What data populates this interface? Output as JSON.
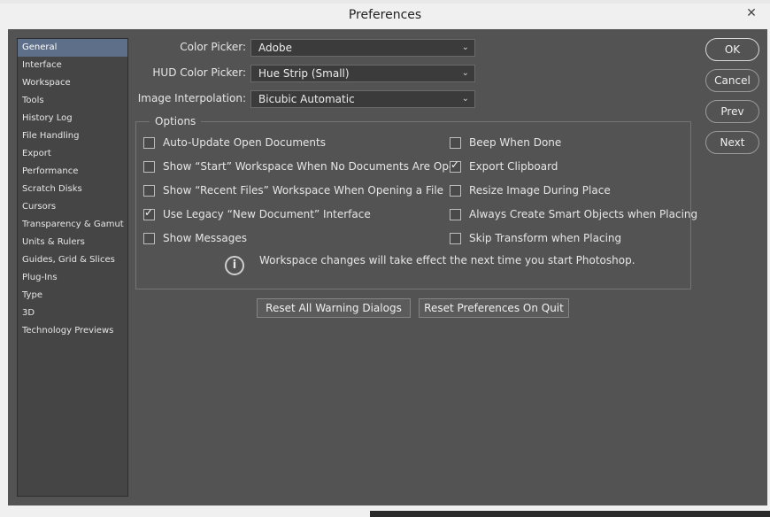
{
  "window": {
    "title": "Preferences",
    "close_glyph": "✕"
  },
  "sidebar": {
    "items": [
      {
        "label": "General",
        "active": true
      },
      {
        "label": "Interface"
      },
      {
        "label": "Workspace"
      },
      {
        "label": "Tools"
      },
      {
        "label": "History Log"
      },
      {
        "label": "File Handling"
      },
      {
        "label": "Export"
      },
      {
        "label": "Performance"
      },
      {
        "label": "Scratch Disks"
      },
      {
        "label": "Cursors"
      },
      {
        "label": "Transparency & Gamut"
      },
      {
        "label": "Units & Rulers"
      },
      {
        "label": "Guides, Grid & Slices"
      },
      {
        "label": "Plug-Ins"
      },
      {
        "label": "Type"
      },
      {
        "label": "3D"
      },
      {
        "label": "Technology Previews"
      }
    ]
  },
  "form": {
    "color_picker": {
      "label": "Color Picker:",
      "value": "Adobe"
    },
    "hud_color_picker": {
      "label": "HUD Color Picker:",
      "value": "Hue Strip (Small)"
    },
    "image_interpolation": {
      "label": "Image Interpolation:",
      "value": "Bicubic Automatic"
    }
  },
  "options": {
    "title": "Options",
    "left": [
      {
        "label": "Auto-Update Open Documents",
        "checked": false
      },
      {
        "label": "Show “Start” Workspace When No Documents Are Open",
        "checked": false
      },
      {
        "label": "Show “Recent Files” Workspace When Opening a File",
        "checked": false
      },
      {
        "label": "Use Legacy “New Document” Interface",
        "checked": true
      },
      {
        "label": "Show Messages",
        "checked": false
      }
    ],
    "right": [
      {
        "label": "Beep When Done",
        "checked": false
      },
      {
        "label": "Export Clipboard",
        "checked": true
      },
      {
        "label": "Resize Image During Place",
        "checked": false
      },
      {
        "label": "Always Create Smart Objects when Placing",
        "checked": false
      },
      {
        "label": "Skip Transform when Placing",
        "checked": false
      }
    ],
    "info_text": "Workspace changes will take effect the next time you start Photoshop.",
    "info_icon": "i"
  },
  "buttons": {
    "reset_warnings": "Reset All Warning Dialogs",
    "reset_prefs": "Reset Preferences On Quit",
    "ok": "OK",
    "cancel": "Cancel",
    "prev": "Prev",
    "next": "Next"
  }
}
